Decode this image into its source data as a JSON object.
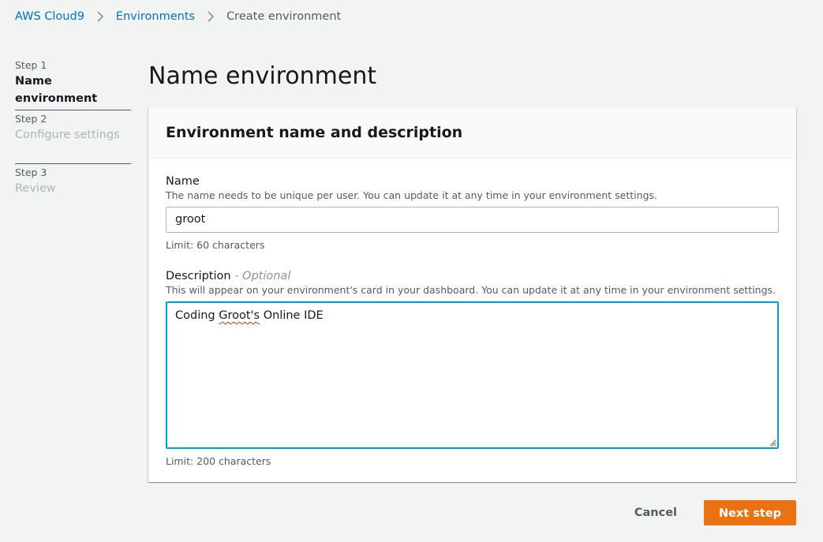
{
  "breadcrumb": {
    "items": [
      "AWS Cloud9",
      "Environments",
      "Create environment"
    ]
  },
  "steps": [
    {
      "num": "Step 1",
      "title": "Name environment"
    },
    {
      "num": "Step 2",
      "title": "Configure settings"
    },
    {
      "num": "Step 3",
      "title": "Review"
    }
  ],
  "page": {
    "title": "Name environment"
  },
  "card": {
    "title": "Environment name and description",
    "name_field": {
      "label": "Name",
      "description": "The name needs to be unique per user. You can update it at any time in your environment settings.",
      "value": "groot",
      "hint": "Limit: 60 characters"
    },
    "description_field": {
      "label": "Description",
      "optional": "- Optional",
      "description": "This will appear on your environment's card in your dashboard. You can update it at any time in your environment settings.",
      "value_before": "Coding ",
      "value_misspelled": "Groot's",
      "value_after": " Online IDE",
      "hint": "Limit: 200 characters"
    }
  },
  "actions": {
    "cancel": "Cancel",
    "next": "Next step"
  },
  "colors": {
    "link": "#0073bb",
    "primary_button": "#ec7211",
    "focus_border": "#00a1c9"
  },
  "icons": {
    "breadcrumb_separator": "chevron-right-icon",
    "textarea_resize": "resize-handle-icon"
  }
}
